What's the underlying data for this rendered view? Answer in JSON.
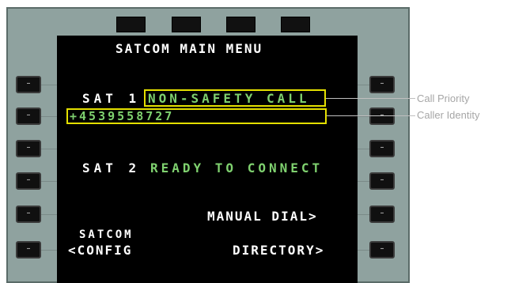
{
  "screen": {
    "title": "SATCOM MAIN MENU",
    "sat1_label": "SAT 1",
    "sat1_status": "NON-SAFETY CALL",
    "sat1_number": "+4539558727",
    "sat2_label": "SAT 2",
    "sat2_status": "READY TO CONNECT",
    "manual_dial": "MANUAL DIAL>",
    "satcom_label": "SATCOM",
    "config": "<CONFIG",
    "directory": "DIRECTORY>"
  },
  "keys": {
    "label": "–"
  },
  "annotations": {
    "call_priority": "Call Priority",
    "caller_identity": "Caller Identity"
  },
  "colors": {
    "bezel": "#8fa29f",
    "screen_bg": "#000000",
    "text_white": "#ffffff",
    "text_green": "#7fd16f",
    "highlight_box": "#e4e000",
    "annotation": "#a6a6a6"
  }
}
